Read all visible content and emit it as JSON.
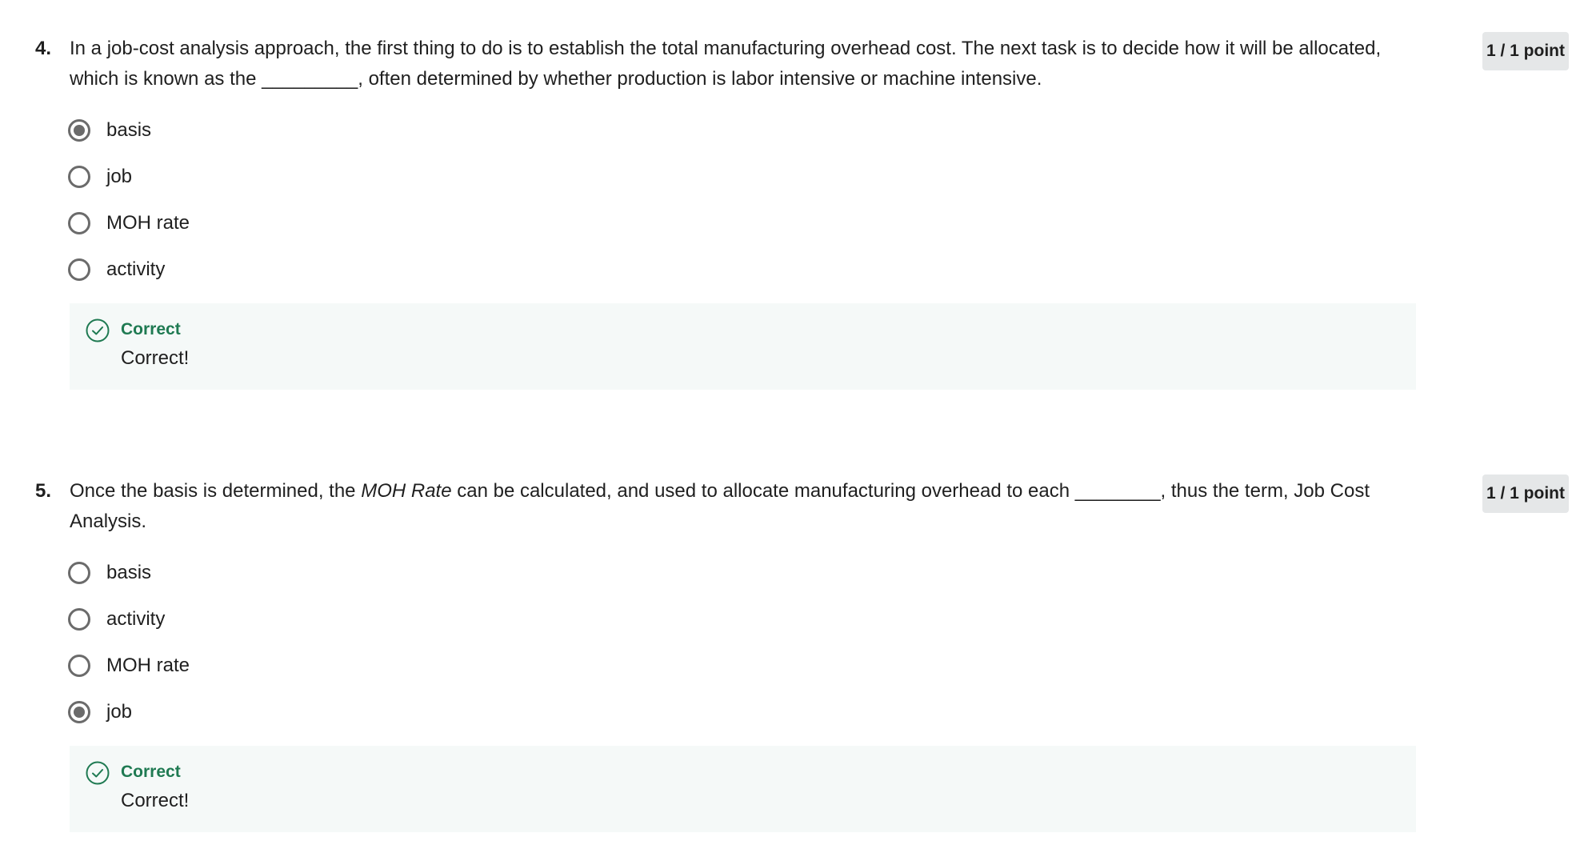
{
  "questions": [
    {
      "number": "4.",
      "text_parts": [
        "In a job-cost analysis approach, the first thing to do is to establish the total manufacturing overhead cost.  The next task is to decide how it will be allocated, which is known as the _________, often determined by whether production is labor intensive or machine intensive."
      ],
      "points": "1 / 1 point",
      "options": [
        {
          "label": "basis",
          "selected": true
        },
        {
          "label": "job",
          "selected": false
        },
        {
          "label": "MOH rate",
          "selected": false
        },
        {
          "label": "activity",
          "selected": false
        }
      ],
      "feedback": {
        "status": "Correct",
        "message": "Correct!",
        "icon": "check-circle-icon"
      }
    },
    {
      "number": "5.",
      "text_before": "Once the basis is determined, the ",
      "text_italic": "MOH Rate",
      "text_after": " can be calculated, and used to allocate manufacturing overhead to each ________, thus the term, Job Cost Analysis.",
      "points": "1 / 1 point",
      "options": [
        {
          "label": "basis",
          "selected": false
        },
        {
          "label": "activity",
          "selected": false
        },
        {
          "label": "MOH rate",
          "selected": false
        },
        {
          "label": "job",
          "selected": true
        }
      ],
      "feedback": {
        "status": "Correct",
        "message": "Correct!",
        "icon": "check-circle-icon"
      }
    }
  ],
  "colors": {
    "correct_green": "#1f7a52",
    "feedback_bg": "#f5f9f8",
    "badge_bg": "#e5e7e8",
    "radio": "#6b6b6b"
  }
}
